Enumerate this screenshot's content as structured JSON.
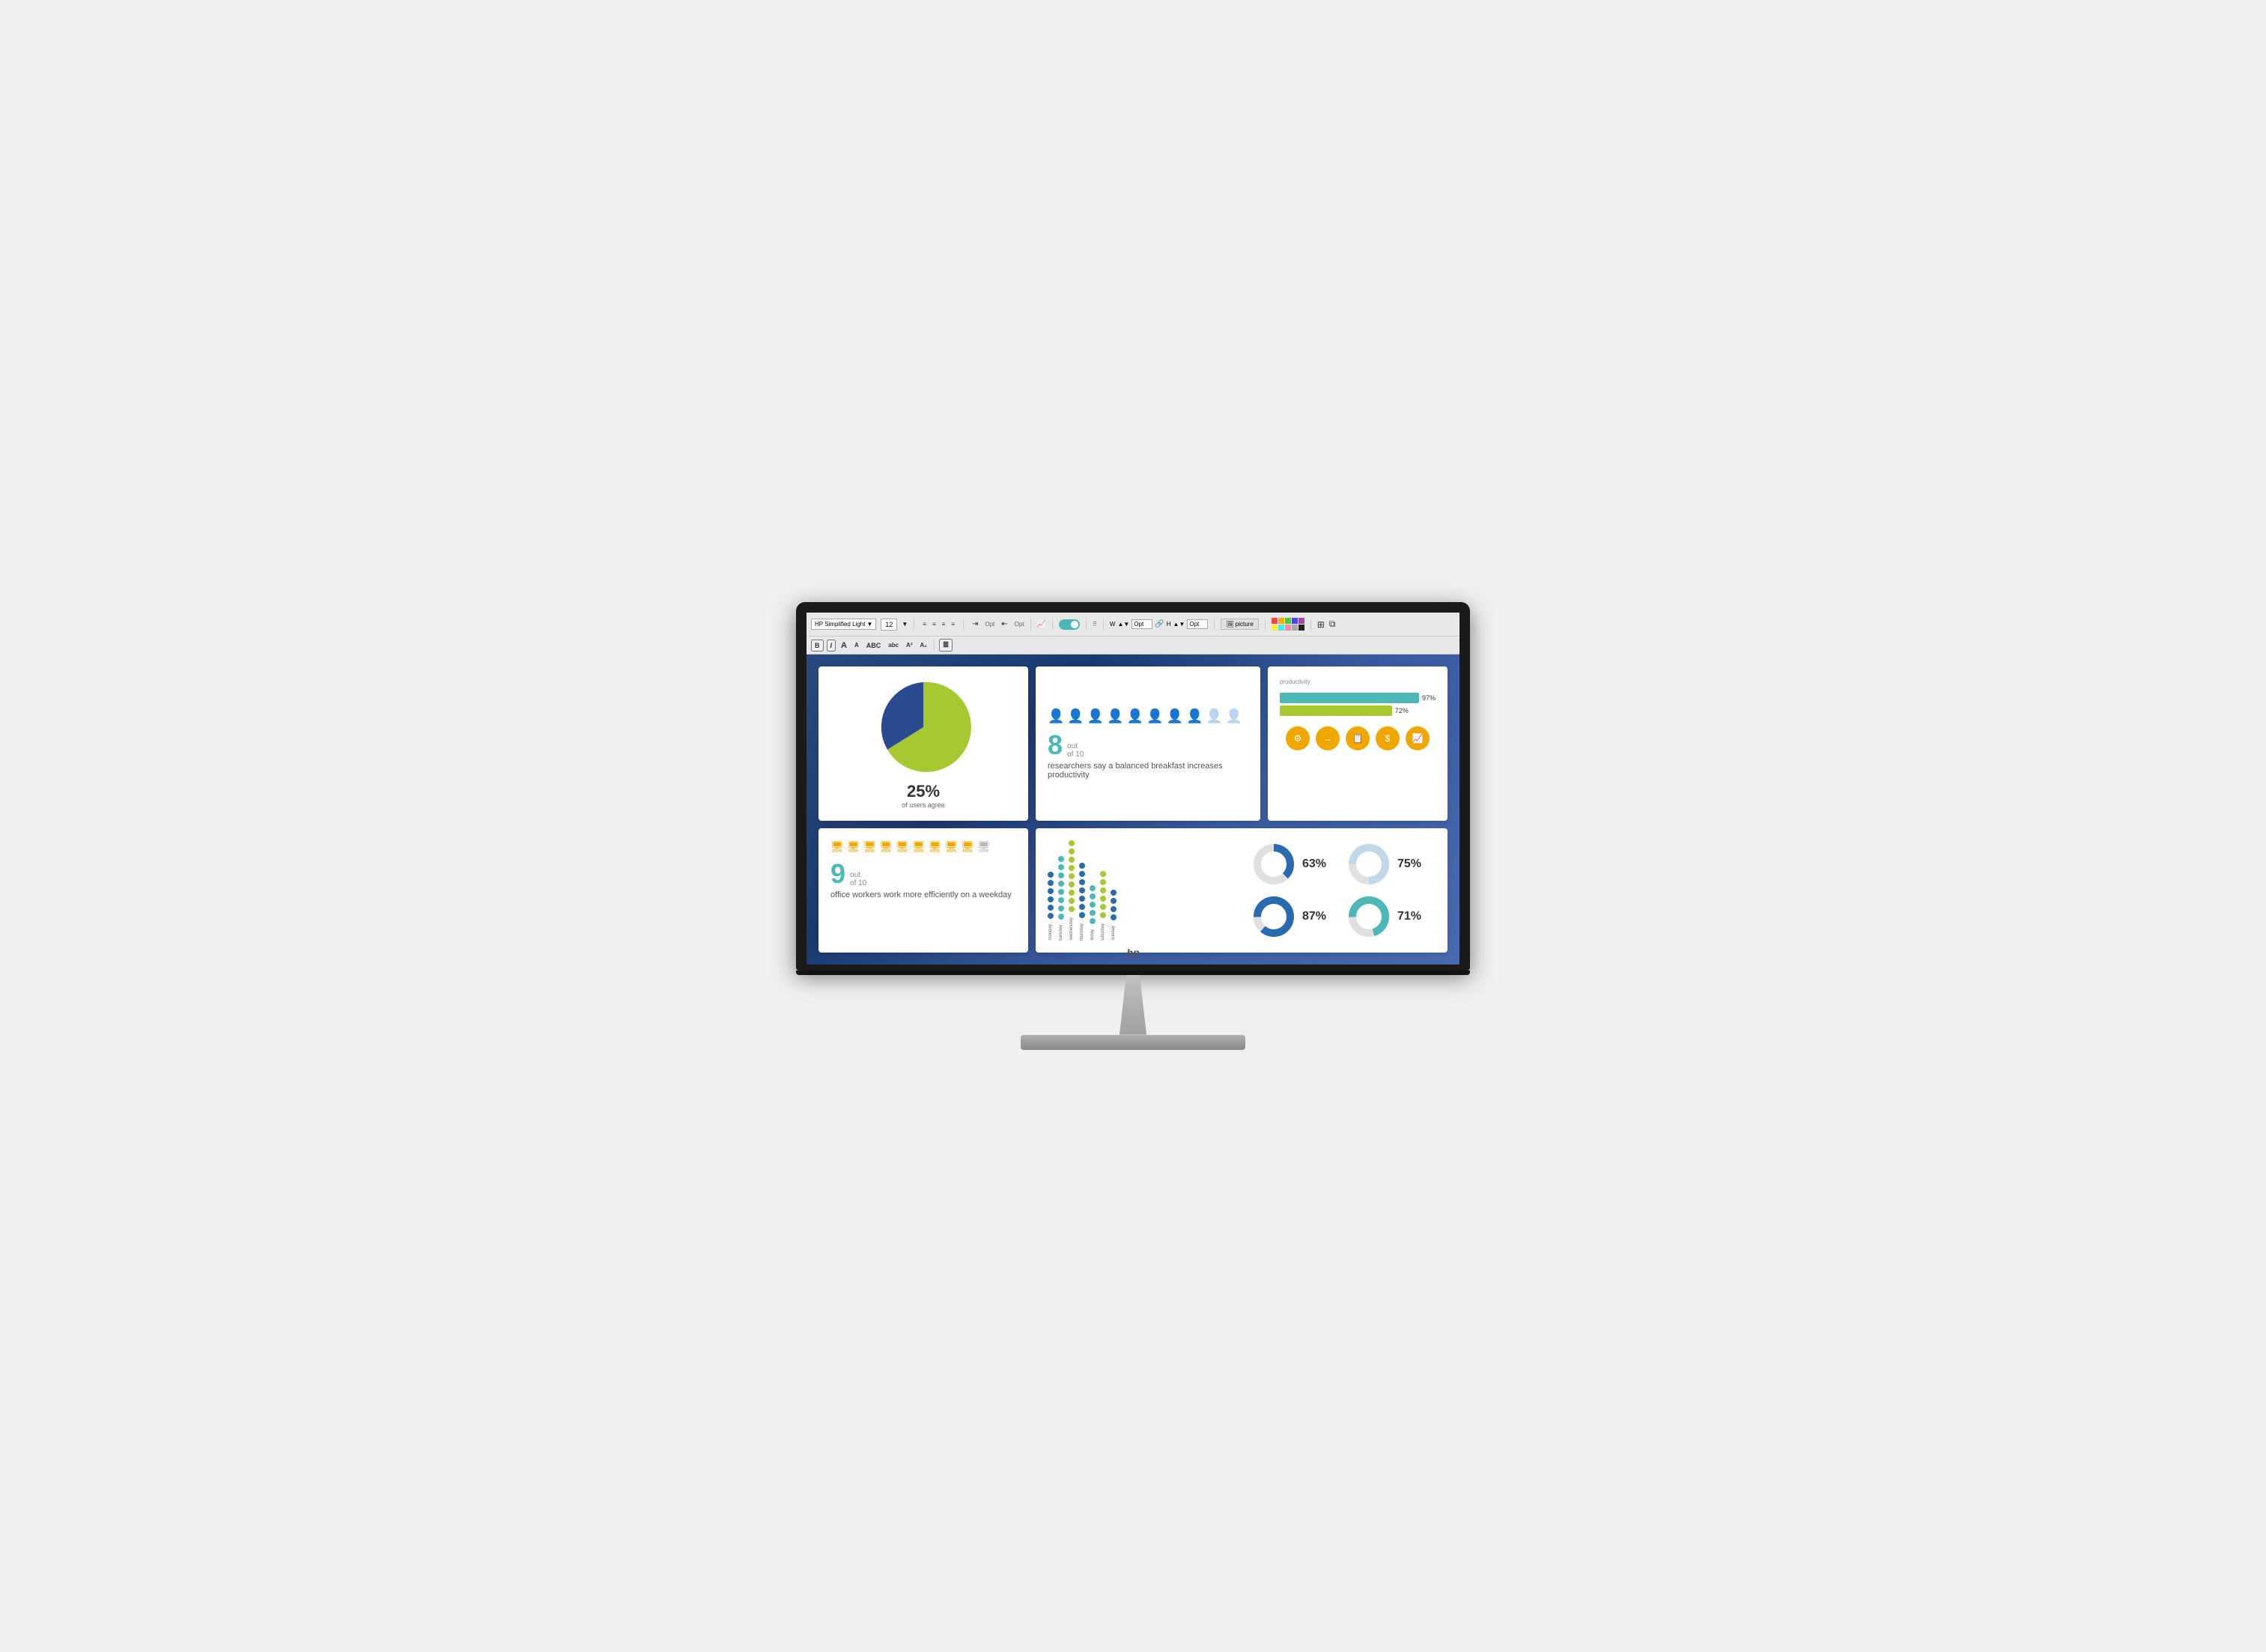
{
  "monitor": {
    "brand": "HP",
    "hp_logo": "hp"
  },
  "toolbar": {
    "font_name": "HP Simplified Light",
    "font_size": "12",
    "bold": "B",
    "italic": "I",
    "font_a1": "A",
    "font_a2": "A",
    "abc": "ABC",
    "abc_lower": "abc",
    "superscript": "A²",
    "subscript": "A₂",
    "picture_label": "picture",
    "width_label": "W",
    "height_label": "H",
    "opt_label": "Opt"
  },
  "pie_card": {
    "percent": "25%",
    "sublabel": "of users agree"
  },
  "breakfast_card": {
    "stat_number": "8",
    "out_of": "out",
    "of_10": "of 10",
    "description": "researchers say a balanced breakfast increases productivity",
    "filled_people": 8,
    "total_people": 10
  },
  "productivity_card": {
    "label": "productivity",
    "bar1_pct": "97%",
    "bar1_width": 95,
    "bar2_pct": "72%",
    "bar2_width": 72,
    "icons": [
      "⚙",
      "→",
      "📋",
      "$",
      "📈"
    ]
  },
  "workers_card": {
    "stat_number": "9",
    "out_of": "out",
    "of_10": "of 10",
    "description": "office workers work more efficiently on a weekday",
    "filled_monitors": 9,
    "total_monitors": 10
  },
  "dot_chart": {
    "days": [
      "monday",
      "tuesday",
      "wednesday",
      "thursday",
      "friday",
      "saturday",
      "sunday"
    ],
    "colors": [
      "#2a6bb0",
      "#4db8b8",
      "#a8c832",
      "#2a6bb0",
      "#4db8b8",
      "#a8c832",
      "#2a6bb0"
    ]
  },
  "donut_charts": [
    {
      "pct": "63%",
      "value": 63,
      "color": "#2a6bb0"
    },
    {
      "pct": "75%",
      "value": 75,
      "color": "#c0d8e8"
    },
    {
      "pct": "87%",
      "value": 87,
      "color": "#2a6bb0"
    },
    {
      "pct": "71%",
      "value": 71,
      "color": "#4db8b8"
    }
  ]
}
